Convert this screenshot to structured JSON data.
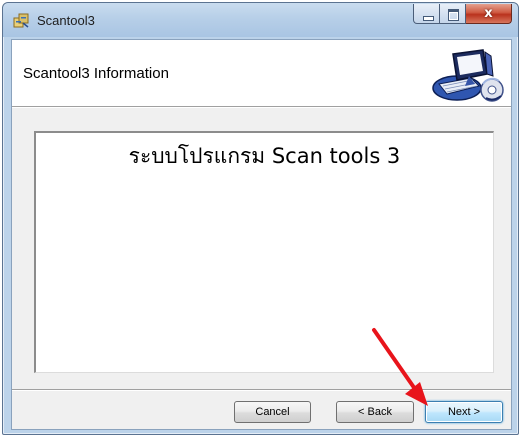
{
  "window": {
    "title": "Scantool3",
    "close_glyph": "x"
  },
  "header": {
    "title": "Scantool3 Information",
    "icon": "computer-disc-icon"
  },
  "content": {
    "text": "ระบบโปรแกรม Scan tools 3"
  },
  "buttons": {
    "cancel_label": "Cancel",
    "back_label": "< Back",
    "next_label": "Next >"
  },
  "annotation": {
    "arrow_color": "#e8141b"
  },
  "colors": {
    "close_button": "#c94a33",
    "next_button_border": "#3c7fb1"
  }
}
